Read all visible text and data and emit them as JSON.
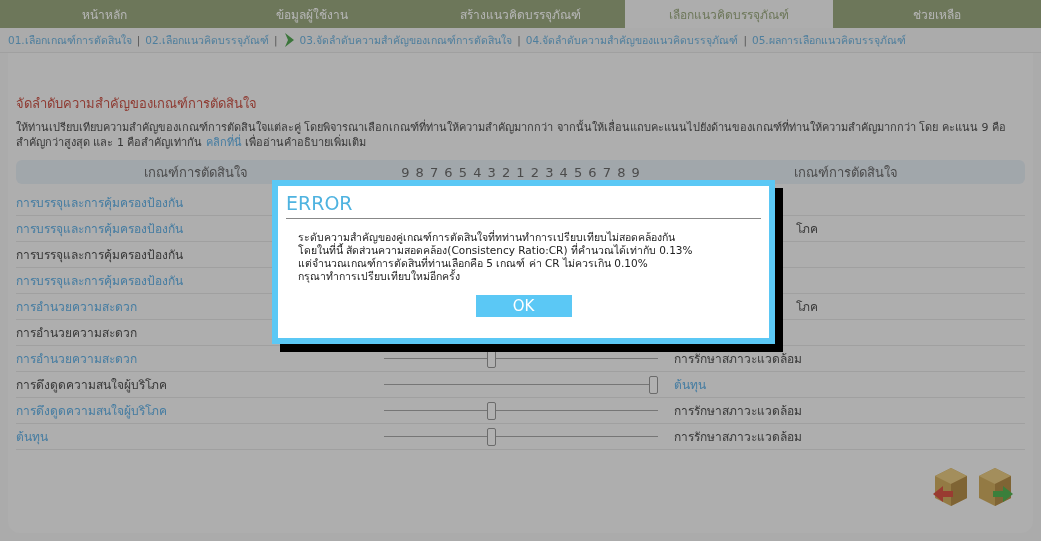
{
  "nav_tabs": [
    {
      "label": "หน้าหลัก",
      "selected": false
    },
    {
      "label": "ข้อมูลผู้ใช้งาน",
      "selected": false
    },
    {
      "label": "สร้างแนวคิดบรรจุภัณฑ์",
      "selected": false
    },
    {
      "label": "เลือกแนวคิดบรรจุภัณฑ์",
      "selected": true
    },
    {
      "label": "ช่วยเหลือ",
      "selected": false
    }
  ],
  "steps": [
    {
      "label": "01.เลือกเกณฑ์การตัดสินใจ",
      "current": false
    },
    {
      "label": "02.เลือกแนวคิดบรรจุภัณฑ์",
      "current": false
    },
    {
      "label": "03.จัดลำดับความสำคัญของเกณฑ์การตัดสินใจ",
      "current": true
    },
    {
      "label": "04.จัดลำดับความสำคัญของแนวคิดบรรจุภัณฑ์",
      "current": false
    },
    {
      "label": "05.ผลการเลือกแนวคิดบรรจุภัณฑ์",
      "current": false
    }
  ],
  "step_separator": "|",
  "heading": "จัดลำดับความสำคัญของเกณฑ์การตัดสินใจ",
  "instructions": "ให้ท่านเปรียบเทียบความสำคัญของเกณฑ์การตัดสินใจแต่ละคู่ โดยพิจารณาเลือกเกณฑ์ที่ท่านให้ความสำคัญมากกว่า จากนั้นให้เลื่อนแถบคะแนนไปยังด้านของเกณฑ์ที่ท่านให้ความสำคัญมากกว่า โดย คะแนน 9 คือสำคัญกว่าสูงสุด และ 1 คือสำคัญเท่ากัน",
  "help_link": "คลิกที่นี่",
  "instructions_end": "เพื่ออ่านคำอธิบายเพิ่มเติม",
  "table": {
    "columns": [
      "เกณฑ์การตัดสินใจ",
      "9 8 7 6 5 4 3 2 1 2 3 4 5 6 7 8 9",
      "เกณฑ์การตัดสินใจ"
    ],
    "rows": [
      {
        "left": {
          "text": "การบรรจุและการคุ้มครองป้องกัน",
          "highlighted": true
        }
      },
      {
        "left": {
          "text": "การบรรจุและการคุ้มครองป้องกัน",
          "highlighted": true
        },
        "right": {
          "text": "โภค",
          "highlighted": false
        }
      },
      {
        "left": {
          "text": "การบรรจุและการคุ้มครองป้องกัน",
          "highlighted": false
        }
      },
      {
        "left": {
          "text": "การบรรจุและการคุ้มครองป้องกัน",
          "highlighted": true
        }
      },
      {
        "left": {
          "text": "การอำนวยความสะดวก",
          "highlighted": true
        },
        "right": {
          "text": "โภค",
          "highlighted": false
        }
      },
      {
        "left": {
          "text": "การอำนวยความสะดวก",
          "highlighted": false
        }
      },
      {
        "left": {
          "text": "การอำนวยความสะดวก",
          "highlighted": true
        },
        "level": 0.39,
        "right": {
          "text": "การรักษาสภาวะแวดล้อม",
          "highlighted": false
        }
      },
      {
        "left": {
          "text": "การดึงดูดความสนใจผู้บริโภค",
          "highlighted": false
        },
        "level": 1,
        "right": {
          "text": "ต้นทุน",
          "highlighted": true
        }
      },
      {
        "left": {
          "text": "การดึงดูดความสนใจผู้บริโภค",
          "highlighted": true
        },
        "level": 0.39,
        "right": {
          "text": "การรักษาสภาวะแวดล้อม",
          "highlighted": false
        }
      },
      {
        "left": {
          "text": "ต้นทุน",
          "highlighted": true
        },
        "level": 0.39,
        "right": {
          "text": "การรักษาสภาวะแวดล้อม",
          "highlighted": false
        }
      }
    ]
  },
  "dialog": {
    "title": "ERROR",
    "message": "ระดับความสำคัญของคู่เกณฑ์การตัดสินใจที่ทท่านทำการเปรียบเทียบไม่สอดคล้องกัน\nโดยในที่นี้ สัดส่วนความสอดคล้อง(Consistency Ratio:CR) ที่คำนวณได้เท่ากับ 0.13%\nแต่จำนวณเกณฑ์การตัดสินที่ท่านเลือกคือ 5 เกณฑ์ ค่า CR ไม่ควรเกิน 0.10%\nกรุณาทำการเปรียบเทียบใหม่อีกครั้ง",
    "button": "OK"
  }
}
